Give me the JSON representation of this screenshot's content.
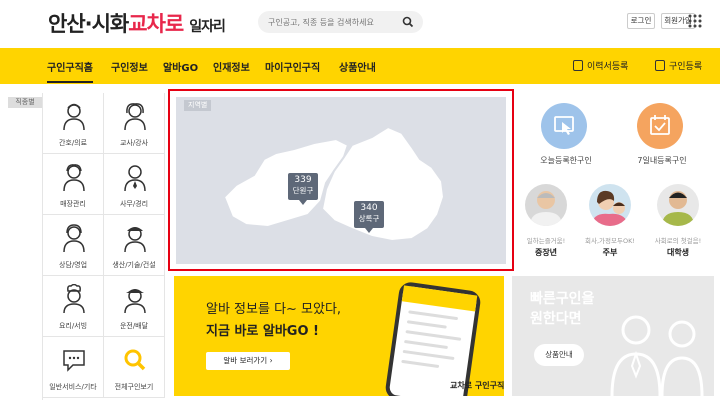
{
  "header": {
    "logo_main": "안산·시화",
    "logo_brand": "교차로",
    "logo_sub": "일자리",
    "search_placeholder": "구인공고, 직종 등을 검색하세요",
    "login": "로그인",
    "signup": "회원가입"
  },
  "nav": {
    "items": [
      "구인구직홈",
      "구인정보",
      "알바GO",
      "인재정보",
      "마이구인구직",
      "상품안내"
    ],
    "resume": "이력서등록",
    "job_post": "구인등록"
  },
  "jobtypes": {
    "tag": "직종별",
    "items": [
      "간호/의료",
      "교사/강사",
      "매장관리",
      "사무/경리",
      "상담/영업",
      "생산/기술/건설",
      "요리/서빙",
      "운전/배달",
      "일반서비스/기타",
      "전체구인보기"
    ]
  },
  "region": {
    "tag": "지역별",
    "pins": [
      {
        "count": "339",
        "name": "단원구"
      },
      {
        "count": "340",
        "name": "상록구"
      }
    ]
  },
  "quick": {
    "today": "오늘등록한구인",
    "week": "7일내등록구인"
  },
  "personas": [
    {
      "desc": "일하는즐거움!",
      "title": "중장년"
    },
    {
      "desc": "회사,가정모두OK!",
      "title": "주부"
    },
    {
      "desc": "사회로의 첫걸음!",
      "title": "대학생"
    }
  ],
  "banner_yellow": {
    "line1": "알바 정보를 다~ 모았다,",
    "line2": "지금 바로 알바GO !",
    "button": "알바 보러가기  ›",
    "logo": "교차로 구인구직"
  },
  "banner_gray": {
    "line1": "빠른구인을",
    "line2": "원한다면",
    "button": "상품안내"
  },
  "colors": {
    "accent_yellow": "#ffd400",
    "brand_pink": "#e8274b",
    "highlight_red": "#e60012"
  }
}
